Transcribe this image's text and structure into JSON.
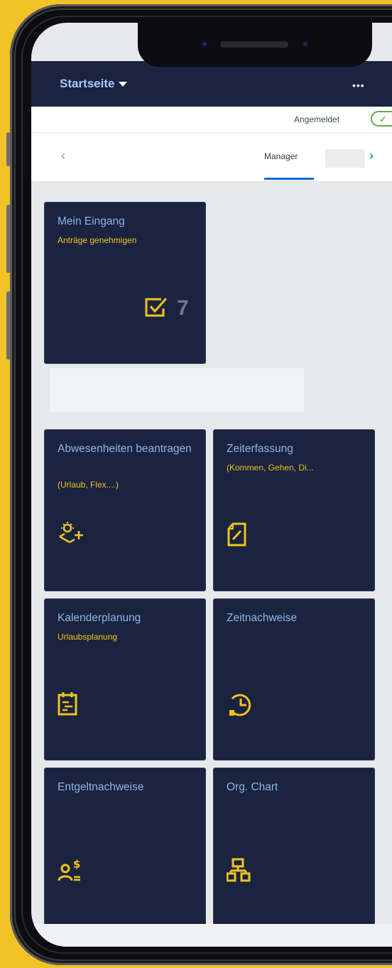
{
  "shell": {
    "title": "Startseite",
    "more": "•••"
  },
  "status": {
    "text": "Angemeldet",
    "toggle_symbol": "✓"
  },
  "nav": {
    "left_arrow": "‹",
    "tab": "Manager",
    "right_arrow": "›"
  },
  "tiles": {
    "inbox": {
      "title": "Mein Eingang",
      "subtitle": "Anträge genehmigen",
      "count": "7"
    },
    "absence": {
      "title": "Abwesenheiten beantragen",
      "subtitle": "(Urlaub, Flex....)"
    },
    "time": {
      "title": "Zeiterfassung",
      "subtitle": "(Kommen, Gehen, Di..."
    },
    "calendar": {
      "title": "Kalenderplanung",
      "subtitle": "Urlaubsplanung"
    },
    "timesheets": {
      "title": "Zeitnachweise"
    },
    "payslips": {
      "title": "Entgeltnachweise"
    },
    "orgchart": {
      "title": "Org. Chart"
    }
  },
  "colors": {
    "tile_bg": "#1a2340",
    "tile_title": "#8fb4e8",
    "accent_yellow": "#f0c419",
    "page_bg": "#f2c326"
  }
}
